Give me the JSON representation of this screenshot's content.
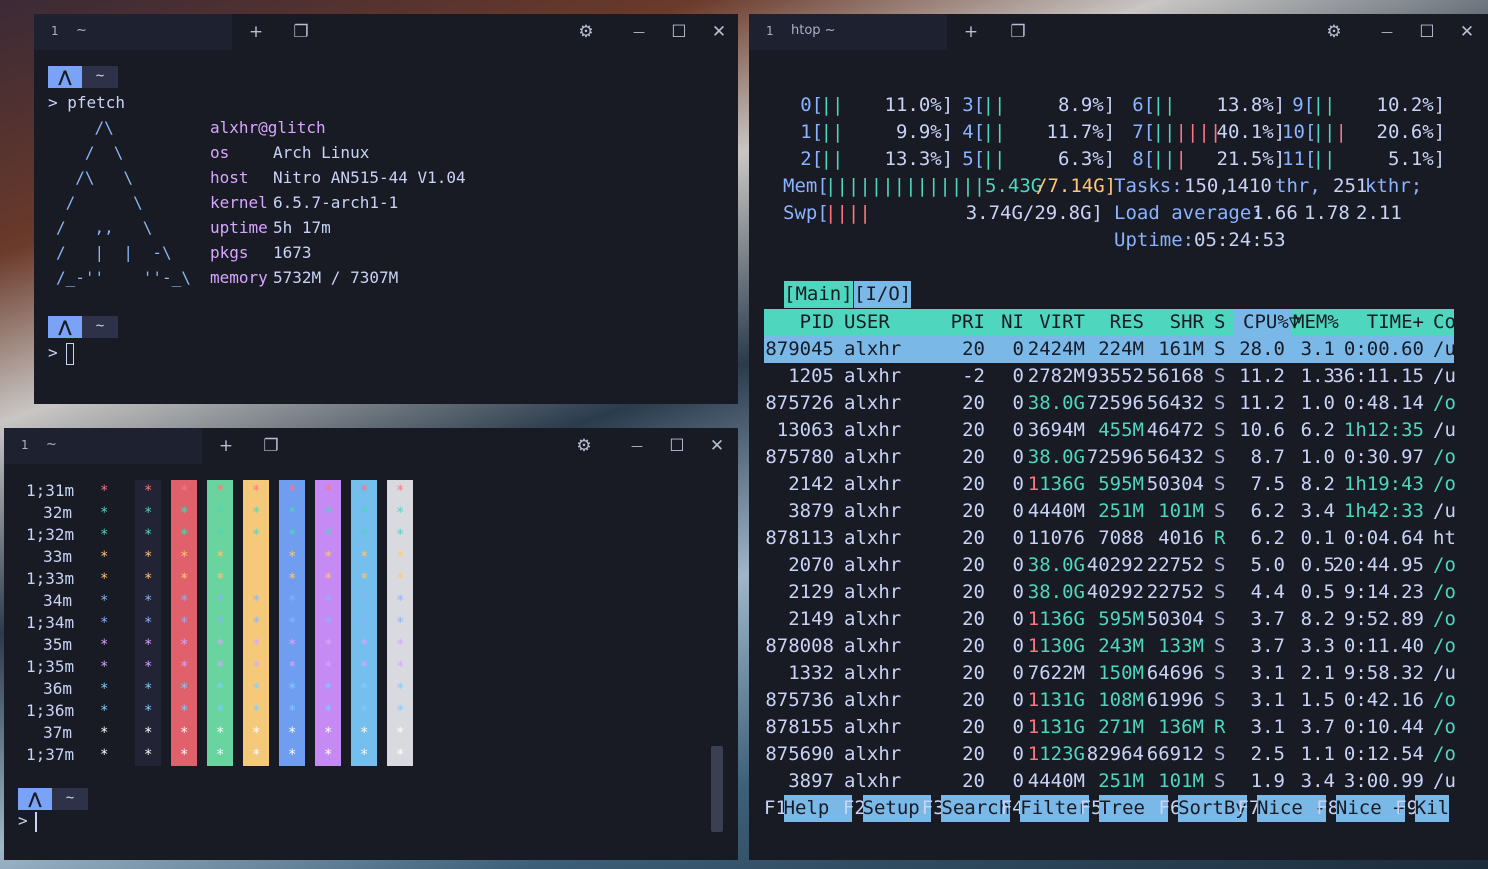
{
  "win1": {
    "tab_num": "1",
    "tab_title": "~",
    "prompt_dir": "~",
    "command": "> pfetch",
    "logo": [
      "    /\\",
      "   /  \\",
      "  /\\   \\",
      " /      \\",
      "/   ,,   \\",
      "/   |  |  -\\",
      "/_-''    ''-_\\"
    ],
    "user": "alxhr@glitch",
    "info": [
      {
        "k": "os",
        "v": "Arch Linux"
      },
      {
        "k": "host",
        "v": "Nitro AN515-44 V1.04"
      },
      {
        "k": "kernel",
        "v": "6.5.7-arch1-1"
      },
      {
        "k": "uptime",
        "v": "5h 17m"
      },
      {
        "k": "pkgs",
        "v": "1673"
      },
      {
        "k": "memory",
        "v": "5732M / 7307M"
      }
    ],
    "prompt2": ">"
  },
  "win2": {
    "tab_num": "1",
    "tab_title": "~",
    "prompt": ">",
    "times": [
      "1;31m",
      "32m",
      "1;32m",
      "33m",
      "1;33m",
      "34m",
      "1;34m",
      "35m",
      "1;35m",
      "36m",
      "1;36m",
      "37m",
      "1;37m"
    ],
    "star_colors": [
      "#ff757f",
      "#4fd6be",
      "#4fd6be",
      "#ffc777",
      "#ffc777",
      "#8bb3ff",
      "#8bb3ff",
      "#d7a6ff",
      "#d7a6ff",
      "#7dcfff",
      "#7dcfff",
      "#ffffff",
      "#ffffff"
    ],
    "bars": [
      "#222436",
      "#e0616b",
      "#69d4a0",
      "#f5c97a",
      "#6f9df0",
      "#c68af5",
      "#74bfee",
      "#d8dae0"
    ],
    "star": "*"
  },
  "win3": {
    "tab_num": "1",
    "tab_title": "htop ~",
    "cpus": [
      {
        "label": "0[",
        "bar": "||",
        "val": "11.0%]"
      },
      {
        "label": "3[",
        "bar": "||",
        "val": "8.9%]"
      },
      {
        "label": "6[",
        "bar": "||",
        "val": "13.8%]"
      },
      {
        "label": "9[",
        "bar": "||",
        "val": "10.2%]"
      },
      {
        "label": "1[",
        "bar": "||",
        "val": "9.9%]"
      },
      {
        "label": "4[",
        "bar": "||",
        "val": "11.7%]"
      },
      {
        "label": "7[",
        "bar": "||||||",
        "val": "40.1%]"
      },
      {
        "label": "10[",
        "bar": "|||",
        "val": "20.6%]"
      },
      {
        "label": "2[",
        "bar": "||",
        "val": "13.3%]"
      },
      {
        "label": "5[",
        "bar": "||",
        "val": "6.3%]"
      },
      {
        "label": "8[",
        "bar": "|||",
        "val": "21.5%]"
      },
      {
        "label": "11[",
        "bar": "||",
        "val": "5.1%]"
      }
    ],
    "mem": {
      "label": "Mem[",
      "bar": "||||||||||||||",
      "used": "5.43G",
      "total": "/7.14G]"
    },
    "swp": {
      "label": "Swp[",
      "bar": "||||",
      "val": "3.74G/29.8G]"
    },
    "tasks": {
      "label": "Tasks:",
      "a": "150,",
      "b": "1410",
      "c": "thr,",
      "d": "251",
      "e": "kthr;"
    },
    "load": {
      "label": "Load average:",
      "a": "1.66",
      "b": "1.78",
      "c": "2.11"
    },
    "uptime": {
      "label": "Uptime:",
      "v": "05:24:53"
    },
    "tabs": {
      "main": "[Main]",
      "io": "[I/O]"
    },
    "header": [
      "PID",
      "USER",
      "PRI",
      "NI",
      "VIRT",
      "RES",
      "SHR",
      "S",
      "CPU%▽",
      "MEM%",
      "TIME+",
      "Co"
    ],
    "rows": [
      [
        "879045",
        "alxhr",
        "20",
        "0",
        "2424M",
        "224M",
        "161M",
        "S",
        "28.0",
        "3.1",
        "0:00.60",
        "/u"
      ],
      [
        "1205",
        "alxhr",
        "-2",
        "0",
        "2782M",
        "93552",
        "56168",
        "S",
        "11.2",
        "1.3",
        "36:11.15",
        "/u"
      ],
      [
        "875726",
        "alxhr",
        "20",
        "0",
        "38.0G",
        "72596",
        "56432",
        "S",
        "11.2",
        "1.0",
        "0:48.14",
        "/o"
      ],
      [
        "13063",
        "alxhr",
        "20",
        "0",
        "3694M",
        "455M",
        "46472",
        "S",
        "10.6",
        "6.2",
        "1h12:35",
        "/u"
      ],
      [
        "875780",
        "alxhr",
        "20",
        "0",
        "38.0G",
        "72596",
        "56432",
        "S",
        "8.7",
        "1.0",
        "0:30.97",
        "/o"
      ],
      [
        "2142",
        "alxhr",
        "20",
        "0",
        "1136G",
        "595M",
        "50304",
        "S",
        "7.5",
        "8.2",
        "1h19:43",
        "/o"
      ],
      [
        "3879",
        "alxhr",
        "20",
        "0",
        "4440M",
        "251M",
        "101M",
        "S",
        "6.2",
        "3.4",
        "1h42:33",
        "/u"
      ],
      [
        "878113",
        "alxhr",
        "20",
        "0",
        "11076",
        "7088",
        "4016",
        "R",
        "6.2",
        "0.1",
        "0:04.64",
        "ht"
      ],
      [
        "2070",
        "alxhr",
        "20",
        "0",
        "38.0G",
        "40292",
        "22752",
        "S",
        "5.0",
        "0.5",
        "20:44.95",
        "/o"
      ],
      [
        "2129",
        "alxhr",
        "20",
        "0",
        "38.0G",
        "40292",
        "22752",
        "S",
        "4.4",
        "0.5",
        "9:14.23",
        "/o"
      ],
      [
        "2149",
        "alxhr",
        "20",
        "0",
        "1136G",
        "595M",
        "50304",
        "S",
        "3.7",
        "8.2",
        "9:52.89",
        "/o"
      ],
      [
        "878008",
        "alxhr",
        "20",
        "0",
        "1130G",
        "243M",
        "133M",
        "S",
        "3.7",
        "3.3",
        "0:11.40",
        "/o"
      ],
      [
        "1332",
        "alxhr",
        "20",
        "0",
        "7622M",
        "150M",
        "64696",
        "S",
        "3.1",
        "2.1",
        "9:58.32",
        "/u"
      ],
      [
        "875736",
        "alxhr",
        "20",
        "0",
        "1131G",
        "108M",
        "61996",
        "S",
        "3.1",
        "1.5",
        "0:42.16",
        "/o"
      ],
      [
        "878155",
        "alxhr",
        "20",
        "0",
        "1131G",
        "271M",
        "136M",
        "R",
        "3.1",
        "3.7",
        "0:10.44",
        "/o"
      ],
      [
        "875690",
        "alxhr",
        "20",
        "0",
        "1123G",
        "82964",
        "66912",
        "S",
        "2.5",
        "1.1",
        "0:12.54",
        "/o"
      ],
      [
        "3897",
        "alxhr",
        "20",
        "0",
        "4440M",
        "251M",
        "101M",
        "S",
        "1.9",
        "3.4",
        "3:00.99",
        "/u"
      ]
    ],
    "fkeys": [
      {
        "k": "F1",
        "l": "Help  "
      },
      {
        "k": "F2",
        "l": "Setup "
      },
      {
        "k": "F3",
        "l": "Search"
      },
      {
        "k": "F4",
        "l": "Filter"
      },
      {
        "k": "F5",
        "l": "Tree  "
      },
      {
        "k": "F6",
        "l": "SortBy"
      },
      {
        "k": "F7",
        "l": "Nice -"
      },
      {
        "k": "F8",
        "l": "Nice +"
      },
      {
        "k": "F9",
        "l": "Kil"
      }
    ]
  },
  "icons": {
    "plus": "+",
    "gear": "⚙",
    "min": "—",
    "max": "☐",
    "close": "✕",
    "window": "❐"
  }
}
